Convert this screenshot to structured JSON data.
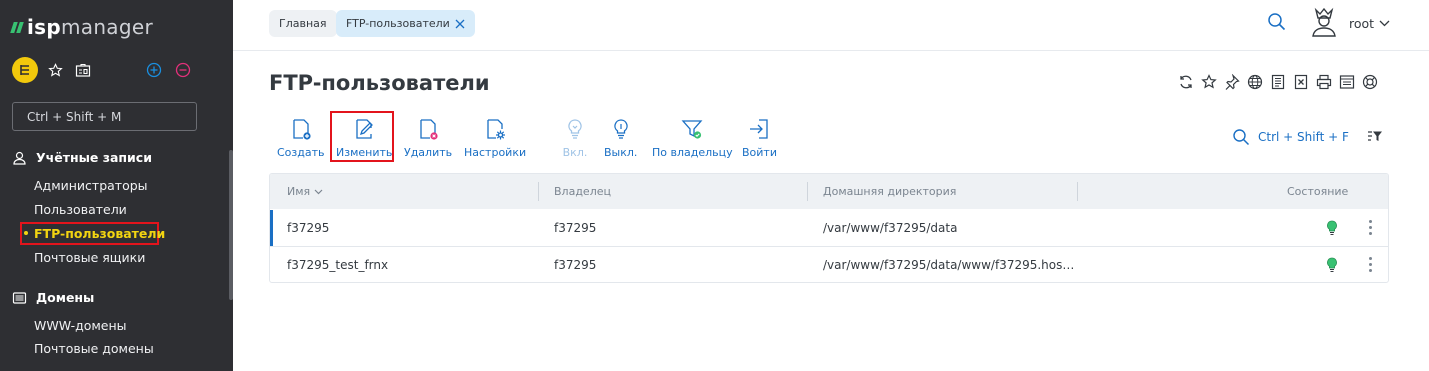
{
  "app": {
    "logo_bold": "isp",
    "logo_light": "manager"
  },
  "sidebar": {
    "command_placeholder": "Ctrl + Shift + M",
    "groups": [
      {
        "label": "Учётные записи",
        "icon": "user-icon",
        "items": [
          "Администраторы",
          "Пользователи",
          "FTP-пользователи",
          "Почтовые ящики"
        ]
      },
      {
        "label": "Домены",
        "icon": "server-icon",
        "items": [
          "WWW-домены",
          "Почтовые домены"
        ]
      }
    ],
    "active_item": "FTP-пользователи"
  },
  "breadcrumbs": [
    "Главная",
    "FTP-пользователи"
  ],
  "user": {
    "name": "root"
  },
  "page": {
    "title": "FTP-пользователи"
  },
  "toolbar": {
    "buttons": [
      {
        "label": "Создать",
        "icon": "create-icon",
        "enabled": true
      },
      {
        "label": "Изменить",
        "icon": "edit-icon",
        "enabled": true,
        "highlighted": true
      },
      {
        "label": "Удалить",
        "icon": "delete-icon",
        "enabled": true
      },
      {
        "label": "Настройки",
        "icon": "settings-icon",
        "enabled": true
      },
      {
        "label": "Вкл.",
        "icon": "bulb-on-icon",
        "enabled": false
      },
      {
        "label": "Выкл.",
        "icon": "bulb-off-icon",
        "enabled": true
      },
      {
        "label": "По владельцу",
        "icon": "filter-owner-icon",
        "enabled": true
      },
      {
        "label": "Войти",
        "icon": "login-icon",
        "enabled": true
      }
    ],
    "quick_search": "Ctrl + Shift + F"
  },
  "table": {
    "columns": [
      "Имя",
      "Владелец",
      "Домашняя директория",
      "Состояние"
    ],
    "rows": [
      {
        "name": "f37295",
        "owner": "f37295",
        "home": "/var/www/f37295/data",
        "state": "on"
      },
      {
        "name": "f37295_test_frnx",
        "owner": "f37295",
        "home": "/var/www/f37295/data/www/f37295.hos…",
        "state": "on"
      }
    ]
  },
  "colors": {
    "sidebar_bg": "#2e2f33",
    "accent_green": "#38c172",
    "link_blue": "#1a6fc4",
    "active_yellow": "#f2d411",
    "highlight_red": "#e3141c"
  }
}
